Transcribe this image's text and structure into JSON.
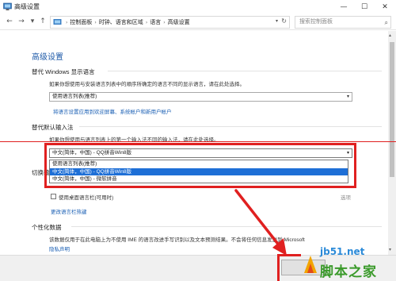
{
  "window": {
    "title": "高级设置",
    "minimize": "—",
    "maximize": "☐",
    "close": "✕"
  },
  "nav": {
    "back": "←",
    "forward": "→",
    "recent": "▾",
    "up": "↑",
    "breadcrumb": [
      "控制面板",
      "时钟、语言和区域",
      "语言",
      "高级设置"
    ],
    "search_placeholder": "搜索控制面板"
  },
  "content": {
    "page_title": "高级设置",
    "display_lang": {
      "heading": "替代 Windows 显示语言",
      "desc": "如果你想使用与安装语言列表中的顺序所确定的语言不同的显示语言，请在此处选择。",
      "select_value": "使用语言列表(推荐)",
      "link": "将语言设置应用到欢迎屏幕、系统帐户和新用户帐户"
    },
    "input_method": {
      "heading": "替代默认输入法",
      "desc": "如果你想使用与语言列表上的第一个输入法不同的输入法，请在此处选择。",
      "select_value": "中文(简体，中国) - QQ拼音Win8版",
      "options": [
        {
          "label": "使用语言列表(推荐)",
          "selected": false
        },
        {
          "label": "中文(简体，中国) - QQ拼音Win8版",
          "selected": true
        },
        {
          "label": "中文(简体，中国) - 微软拼音",
          "selected": false
        }
      ]
    },
    "switch_input": {
      "heading": "切换输",
      "checkbox_label": "使用桌面语言栏(可用时)",
      "options_link": "选项",
      "hotkey_link": "更改语言栏热键"
    },
    "personalization": {
      "heading": "个性化数据",
      "desc": "该数据仅用于在此电脑上为不使用 IME 的语言改进手写识别以及文本预测结果。不会将任何信息发送到 Microsoft",
      "link": "隐私声明"
    }
  },
  "watermark": {
    "site": "jb51.net",
    "name": "脚本之家"
  },
  "colors": {
    "heading_blue": "#1e5aa8",
    "link_blue": "#1a5fb4",
    "highlight_red": "#e02020",
    "selection_blue": "#1e6fd6"
  }
}
